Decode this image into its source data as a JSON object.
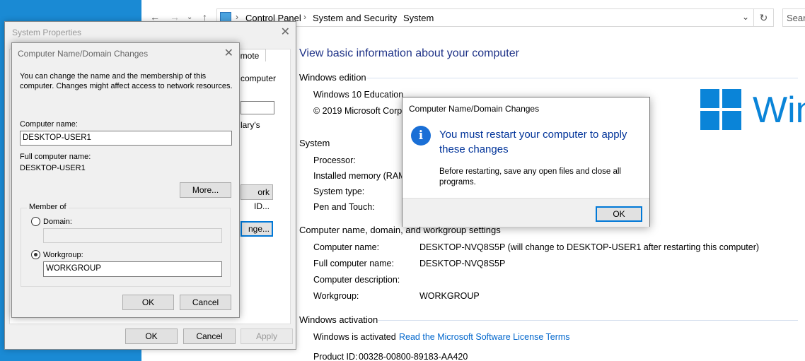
{
  "control_panel": {
    "breadcrumb": [
      "Control Panel",
      "System and Security",
      "System"
    ],
    "search_placeholder": "Sear",
    "page_title": "View basic information about your computer",
    "windows_edition": {
      "header": "Windows edition",
      "edition": "Windows 10 Education",
      "copyright": "© 2019 Microsoft Corpo",
      "logo_text": "Win"
    },
    "system": {
      "header": "System",
      "processor_label": "Processor:",
      "memory_label": "Installed memory (RAM",
      "type_label": "System type:",
      "pen_label": "Pen and Touch:"
    },
    "computer_name_section": {
      "header": "Computer name, domain, and workgroup settings",
      "computer_name_label": "Computer name:",
      "computer_name_value": "DESKTOP-NVQ8S5P (will change to DESKTOP-USER1 after restarting this computer)",
      "full_name_label": "Full computer name:",
      "full_name_value": "DESKTOP-NVQ8S5P",
      "description_label": "Computer description:",
      "workgroup_label": "Workgroup:",
      "workgroup_value": "WORKGROUP"
    },
    "activation": {
      "header": "Windows activation",
      "status": "Windows is activated",
      "license_link": "Read the Microsoft Software License Terms",
      "product_id_label": "Product ID:",
      "product_id_value": "00328-00800-89183-AA420"
    }
  },
  "system_properties": {
    "title": "System Properties",
    "tab_remote": "emote",
    "partial_computer": "computer",
    "partial_library": "lary's",
    "network_id_button": "ork ID...",
    "change_button": "nge...",
    "ok": "OK",
    "cancel": "Cancel",
    "apply": "Apply"
  },
  "name_changes": {
    "title": "Computer Name/Domain Changes",
    "description_line1": "You can change the name and the membership of this",
    "description_line2": "computer. Changes might affect access to network resources.",
    "computer_name_label": "Computer name:",
    "computer_name_value": "DESKTOP-USER1",
    "full_name_label": "Full computer name:",
    "full_name_value": "DESKTOP-USER1",
    "more_button": "More...",
    "member_of_label": "Member of",
    "domain_label": "Domain:",
    "domain_value": "",
    "workgroup_label": "Workgroup:",
    "workgroup_value": "WORKGROUP",
    "ok": "OK",
    "cancel": "Cancel"
  },
  "message_box": {
    "title": "Computer Name/Domain Changes",
    "icon": "info-icon",
    "main_line1": "You must restart your computer to apply",
    "main_line2": "these changes",
    "sub_line1": "Before restarting, save any open files and close all",
    "sub_line2": "programs.",
    "ok": "OK"
  }
}
